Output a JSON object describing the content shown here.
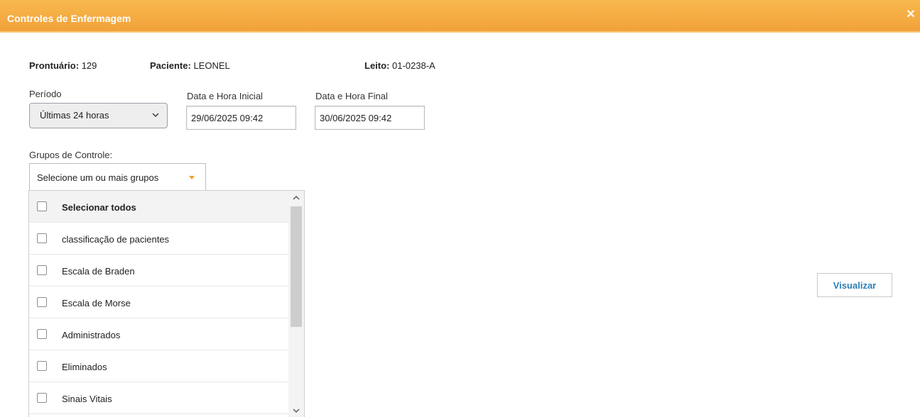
{
  "window": {
    "title": "Controles de Enfermagem"
  },
  "patient": {
    "prontuario_label": "Prontuário:",
    "prontuario_value": "129",
    "paciente_label": "Paciente:",
    "paciente_value": "LEONEL",
    "leito_label": "Leito:",
    "leito_value": "01-0238-A"
  },
  "filters": {
    "periodo_label": "Período",
    "periodo_selected": "Últimas 24 horas",
    "inicio_label": "Data e Hora Inicial",
    "inicio_value": "29/06/2025 09:42",
    "fim_label": "Data e Hora Final",
    "fim_value": "30/06/2025 09:42"
  },
  "grupos": {
    "label": "Grupos de Controle:",
    "placeholder": "Selecione um ou mais grupos",
    "items": [
      {
        "label": "Selecionar todos",
        "checked": false
      },
      {
        "label": "classificação de pacientes",
        "checked": false
      },
      {
        "label": "Escala de Braden",
        "checked": false
      },
      {
        "label": "Escala de Morse",
        "checked": false
      },
      {
        "label": "Administrados",
        "checked": false
      },
      {
        "label": "Eliminados",
        "checked": false
      },
      {
        "label": "Sinais Vitais",
        "checked": false
      }
    ]
  },
  "actions": {
    "visualizar": "Visualizar"
  },
  "colors": {
    "titlebar": "#f2a23a",
    "accent_caret": "#f0a030",
    "button_text": "#2b7fb5"
  }
}
